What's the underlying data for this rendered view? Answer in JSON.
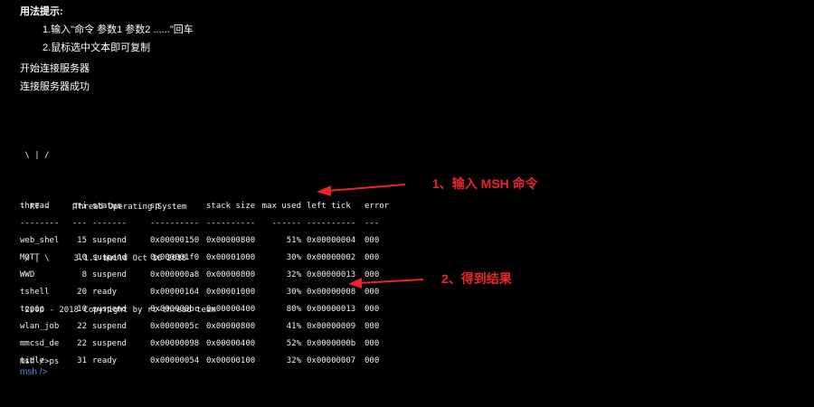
{
  "hint": {
    "title": "用法提示:",
    "line1": "1.输入\"命令 参数1 参数2 ......\"回车",
    "line2": "2.鼠标选中文本即可复制"
  },
  "connection": {
    "start": "开始连接服务器",
    "success": "连接服务器成功"
  },
  "banner": {
    "line1": " \\ | /",
    "line2": "- RT -     Thread Operating System",
    "line3": " / | \\     3.1.1 build Oct 16 2018",
    "line4": " 2006 - 2018 Copyright by rt-thread team"
  },
  "command_line": "msh />ps",
  "table": {
    "headers": [
      "thread",
      "pri",
      "status",
      "sp",
      "stack size",
      "max used",
      "left tick",
      "error"
    ],
    "separators": [
      "--------",
      "---",
      "-------",
      "----------",
      "----------",
      "------",
      "----------",
      "---"
    ],
    "rows": [
      [
        "web_shel",
        "15",
        "suspend",
        "0x00000150",
        "0x00000800",
        "51%",
        "0x00000004",
        "000"
      ],
      [
        "MQTT",
        "10",
        "suspend",
        "0x000001f0",
        "0x00001000",
        "30%",
        "0x00000002",
        "000"
      ],
      [
        "WWD",
        "8",
        "suspend",
        "0x000000a8",
        "0x00000800",
        "32%",
        "0x00000013",
        "000"
      ],
      [
        "tshell",
        "20",
        "ready",
        "0x00000164",
        "0x00001000",
        "30%",
        "0x00000008",
        "000"
      ],
      [
        "tcpip",
        "10",
        "suspend",
        "0x000000bc",
        "0x00000400",
        "80%",
        "0x00000013",
        "000"
      ],
      [
        "wlan_job",
        "22",
        "suspend",
        "0x0000005c",
        "0x00000800",
        "41%",
        "0x00000009",
        "000"
      ],
      [
        "mmcsd_de",
        "22",
        "suspend",
        "0x00000098",
        "0x00000400",
        "52%",
        "0x0000000b",
        "000"
      ],
      [
        "tidle",
        "31",
        "ready",
        "0x00000054",
        "0x00000100",
        "32%",
        "0x00000007",
        "000"
      ]
    ]
  },
  "prompt": "msh />",
  "annotations": {
    "step1": "1、输入 MSH 命令",
    "step2": "2、得到结果",
    "color": "#e8262c"
  },
  "colors": {
    "background": "#000000",
    "text": "#f0f0f0",
    "prompt": "#4a90e2"
  }
}
